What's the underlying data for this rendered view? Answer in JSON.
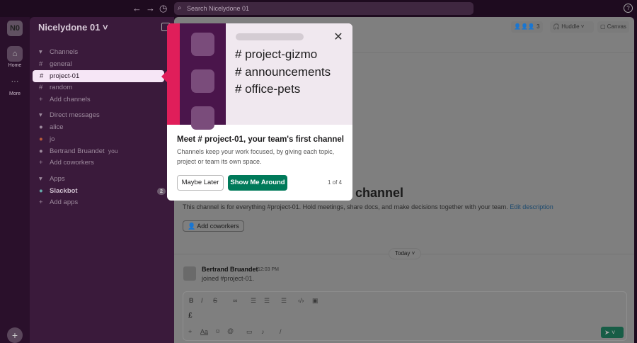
{
  "topbar": {
    "search_placeholder": "Search Nicelydone 01",
    "back": "←",
    "forward": "→",
    "history": "◷",
    "help": "?"
  },
  "rail": {
    "workspace_initials": "N0",
    "home": "Home",
    "more": "More"
  },
  "sidebar": {
    "workspace": "Nicelydone 01",
    "channels_header": "Channels",
    "channels": [
      "general",
      "project-01",
      "random"
    ],
    "add_channels": "Add channels",
    "dm_header": "Direct messages",
    "dms": [
      "alice",
      "jo",
      "Bertrand Bruandet"
    ],
    "you": "you",
    "add_coworkers": "Add coworkers",
    "apps_header": "Apps",
    "apps": [
      {
        "name": "Slackbot",
        "badge": "2"
      }
    ],
    "add_apps": "Add apps"
  },
  "header": {
    "member_count": "3",
    "huddle": "Huddle",
    "canvas": "Canvas"
  },
  "popup": {
    "channels": [
      "# project-gizmo",
      "# announcements",
      "# office-pets"
    ],
    "title": "Meet # project-01, your team's first channel",
    "desc": "Channels keep your work focused, by giving each topic, project or team its own space.",
    "maybe_later": "Maybe Later",
    "show_me": "Show Me Around",
    "step": "1 of 4"
  },
  "main": {
    "intro_title_tail": "channel",
    "intro_desc": "This channel is for everything #project-01. Hold meetings, share docs, and make decisions together with your team.",
    "edit_description": "Edit description",
    "add_coworkers": "Add coworkers",
    "date_divider": "Today",
    "message": {
      "author": "Bertrand Bruandet",
      "time": "12:03 PM",
      "text": "joined #project-01."
    },
    "composer_text": "£"
  },
  "colors": {
    "accent_green": "#007a5a",
    "pink": "#e01e5a",
    "plum": "#4a154b"
  }
}
